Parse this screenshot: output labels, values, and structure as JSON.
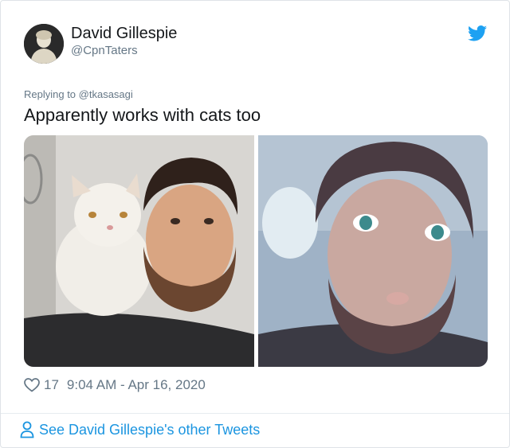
{
  "tweet": {
    "author_name": "David Gillespie",
    "author_handle": "@CpnTaters",
    "replying_to": "Replying to @tkasasagi",
    "text": "Apparently works with cats too",
    "likes": "17",
    "timestamp": "9:04 AM - Apr 16, 2020",
    "footer_link": "See David Gillespie's other Tweets"
  },
  "icons": {
    "brand": "twitter-bird-icon",
    "like": "heart-icon",
    "profile": "person-icon"
  },
  "colors": {
    "accent": "#1da1f2",
    "link": "#1b95e0",
    "secondary_text": "#657786"
  }
}
